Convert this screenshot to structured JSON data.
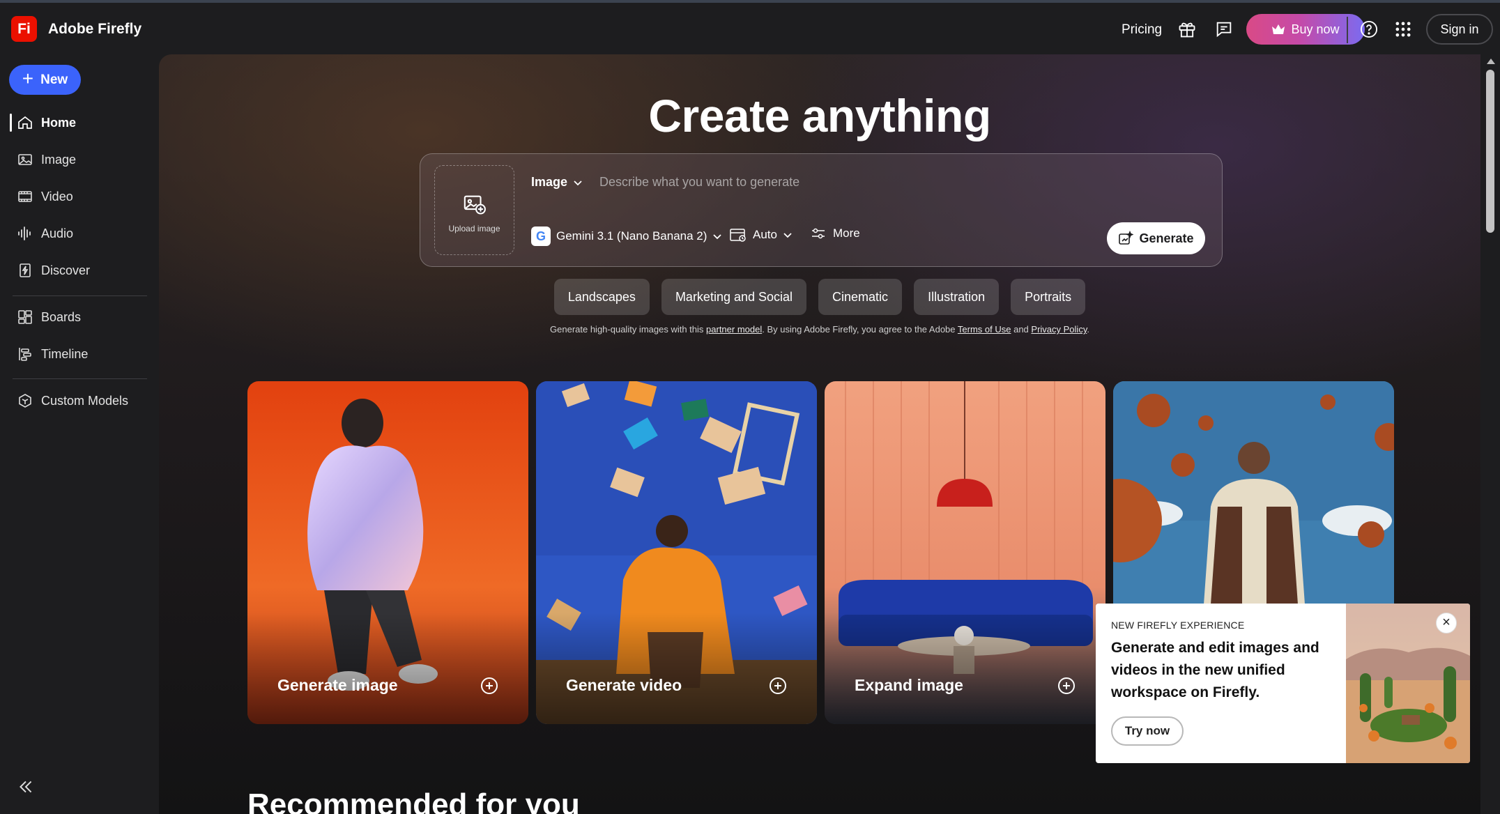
{
  "app": {
    "logo_text": "Fi",
    "name": "Adobe Firefly"
  },
  "topbar": {
    "pricing": "Pricing",
    "buy_now": "Buy now",
    "sign_in": "Sign in",
    "icons": [
      "gift-icon",
      "feedback-icon",
      "help-icon",
      "apps-grid-icon"
    ]
  },
  "sidebar": {
    "new_label": "New",
    "items": [
      {
        "label": "Home",
        "icon": "home-icon",
        "active": true
      },
      {
        "label": "Image",
        "icon": "image-icon"
      },
      {
        "label": "Video",
        "icon": "video-icon"
      },
      {
        "label": "Audio",
        "icon": "audio-icon"
      },
      {
        "label": "Discover",
        "icon": "discover-icon"
      },
      {
        "label": "Boards",
        "icon": "boards-icon"
      },
      {
        "label": "Timeline",
        "icon": "timeline-icon"
      },
      {
        "label": "Custom Models",
        "icon": "custom-models-icon"
      }
    ]
  },
  "hero": {
    "title": "Create anything",
    "upload_label": "Upload image",
    "mode": "Image",
    "prompt_placeholder": "Describe what you want to generate",
    "model": "Gemini 3.1 (Nano Banana 2)",
    "aspect": "Auto",
    "more": "More",
    "generate": "Generate"
  },
  "chips": [
    "Landscapes",
    "Marketing and Social",
    "Cinematic",
    "Illustration",
    "Portraits"
  ],
  "legal": {
    "p1": "Generate high-quality images with this ",
    "link1": "partner model",
    "p2": ". By using Adobe Firefly, you agree to the Adobe ",
    "link2": "Terms of Use",
    "p3": " and ",
    "link3": "Privacy Policy",
    "p4": "."
  },
  "cards": [
    {
      "label": "Generate image"
    },
    {
      "label": "Generate video"
    },
    {
      "label": "Expand image"
    },
    {
      "label": ""
    }
  ],
  "recommended_title": "Recommended for you",
  "promo": {
    "kicker": "NEW FIREFLY EXPERIENCE",
    "headline": "Generate and edit images and videos in the new unified workspace on Firefly.",
    "cta": "Try now"
  },
  "colors": {
    "accent_blue": "#3b63fb",
    "brand_red": "#eb1000",
    "buy_gradient_start": "#d94a86",
    "buy_gradient_end": "#7b6bf0"
  }
}
